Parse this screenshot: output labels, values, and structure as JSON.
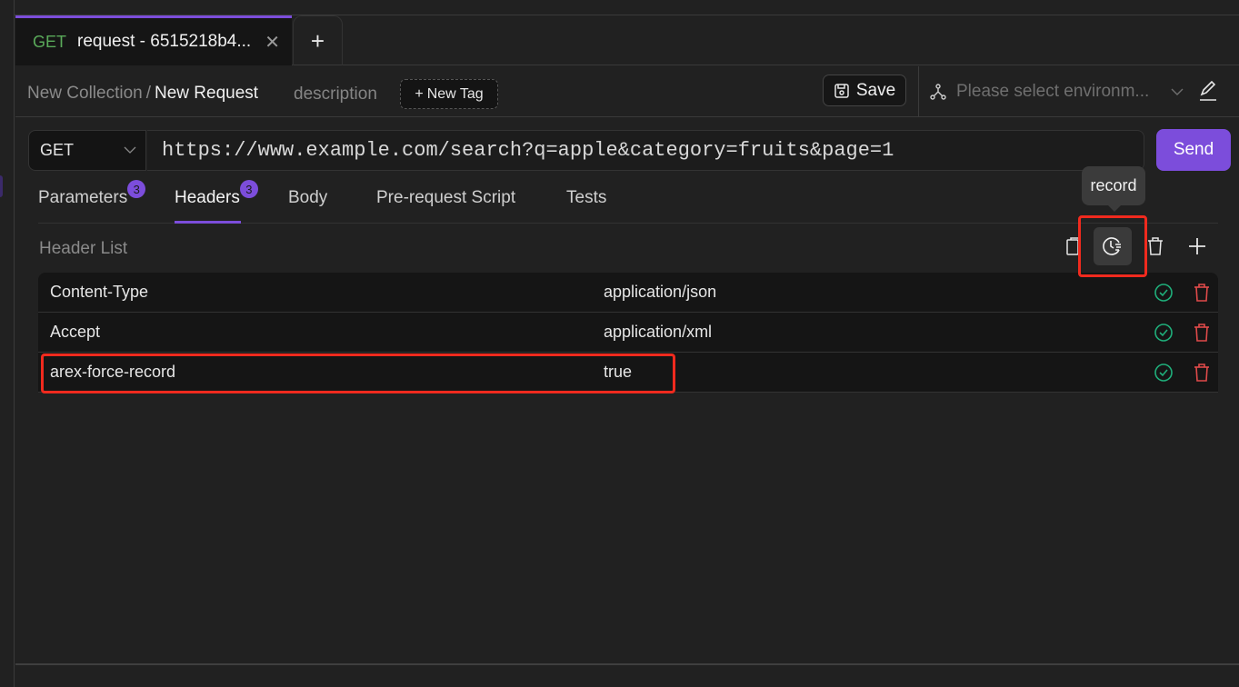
{
  "tab": {
    "method": "GET",
    "title": "request - 6515218b4...",
    "close_icon": "close-icon",
    "add_icon": "plus-icon",
    "method_color": "#5aaa5a",
    "active_color": "#7c4ddb"
  },
  "breadcrumb": {
    "collection": "New Collection",
    "separator": "/",
    "request": "New Request"
  },
  "description_label": "description",
  "new_tag_label": "New Tag",
  "save_label": "Save",
  "environment": {
    "placeholder": "Please select environm...",
    "icon": "environment-icon",
    "edit_icon": "pencil-icon"
  },
  "request": {
    "method": "GET",
    "url": "https://www.example.com/search?q=apple&category=fruits&page=1",
    "send_label": "Send"
  },
  "tabs": [
    {
      "label": "Parameters",
      "badge": "3",
      "active": false
    },
    {
      "label": "Headers",
      "badge": "3",
      "active": true
    },
    {
      "label": "Body",
      "badge": null,
      "active": false
    },
    {
      "label": "Pre-request Script",
      "badge": null,
      "active": false
    },
    {
      "label": "Tests",
      "badge": null,
      "active": false
    }
  ],
  "header_list": {
    "title": "Header List",
    "tools": [
      "copy-icon",
      "record-icon",
      "trash-icon",
      "plus-icon"
    ],
    "tooltip": "record",
    "rows": [
      {
        "key": "Content-Type",
        "value": "application/json",
        "enabled": true
      },
      {
        "key": "Accept",
        "value": "application/xml",
        "enabled": true
      },
      {
        "key": "arex-force-record",
        "value": "true",
        "enabled": true
      }
    ]
  },
  "colors": {
    "accent": "#7c4ddb",
    "success": "#1fae7a",
    "danger": "#e04a4a",
    "highlight": "#f02a1e"
  }
}
